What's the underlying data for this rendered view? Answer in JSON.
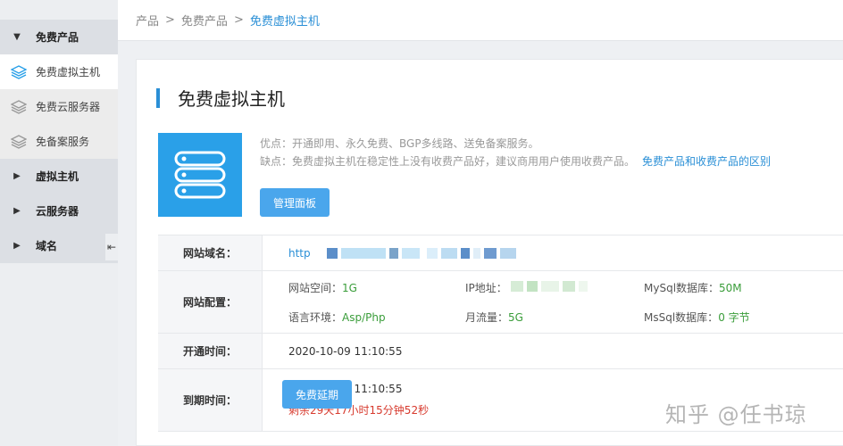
{
  "sidebar": {
    "items": [
      {
        "label": "免费产品",
        "type": "group",
        "expanded": true
      },
      {
        "label": "免费虚拟主机",
        "type": "sub",
        "active": true
      },
      {
        "label": "免费云服务器",
        "type": "sub"
      },
      {
        "label": "免备案服务",
        "type": "sub"
      },
      {
        "label": "虚拟主机",
        "type": "group"
      },
      {
        "label": "云服务器",
        "type": "group"
      },
      {
        "label": "域名",
        "type": "group"
      }
    ]
  },
  "breadcrumb": {
    "items": [
      "产品",
      "免费产品",
      "免费虚拟主机"
    ],
    "separator": ">"
  },
  "main": {
    "title": "免费虚拟主机",
    "pros": "优点：开通即用、永久免费、BGP多线路、送免备案服务。",
    "cons": "缺点：免费虚拟主机在稳定性上没有收费产品好，建议商用用户使用收费产品。",
    "compare_link": "免费产品和收费产品的区别",
    "manage_button": "管理面板"
  },
  "info": {
    "domain_label": "网站域名：",
    "domain_prefix": "http",
    "config_label": "网站配置：",
    "config": {
      "space_label": "网站空间：",
      "space_value": "1G",
      "ip_label": "IP地址：",
      "mysql_label": "MySql数据库：",
      "mysql_value": "50M",
      "lang_label": "语言环境：",
      "lang_value": "Asp/Php",
      "traffic_label": "月流量：",
      "traffic_value": "5G",
      "mssql_label": "MsSql数据库：",
      "mssql_value": "0 字节"
    },
    "open_label": "开通时间：",
    "open_time": "2020-10-09 11:10:55",
    "expire_label": "到期时间：",
    "expire_time": "2020-11-08 11:10:55",
    "remaining": "剩余29天17小时15分钟52秒",
    "renew_button": "免费延期"
  },
  "watermark": "知乎 @任书琼",
  "colors": {
    "accent": "#2a8fd6",
    "button": "#4aa6ec",
    "green": "#3a9d3a",
    "red": "#d73a2e"
  }
}
